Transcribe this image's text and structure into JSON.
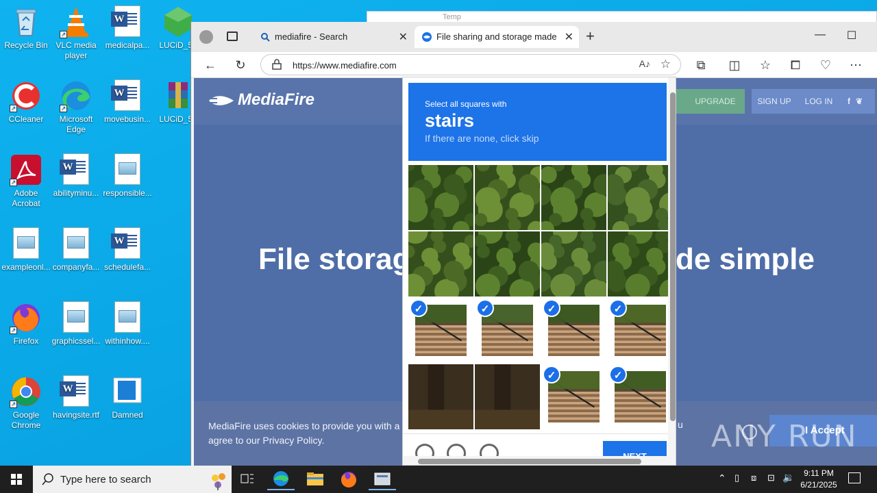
{
  "desktop": {
    "icons": [
      {
        "label": "Recycle Bin",
        "name": "recycle-bin-icon"
      },
      {
        "label": "VLC media player",
        "name": "vlc-icon"
      },
      {
        "label": "medicalpa...",
        "name": "word-doc-icon"
      },
      {
        "label": "LUCiD_5e",
        "name": "lucid-app-icon"
      },
      {
        "label": "CCleaner",
        "name": "ccleaner-icon"
      },
      {
        "label": "Microsoft Edge",
        "name": "edge-icon"
      },
      {
        "label": "movebusin...",
        "name": "word-doc-icon"
      },
      {
        "label": "LUCiD_5e",
        "name": "winrar-icon"
      },
      {
        "label": "Adobe Acrobat",
        "name": "acrobat-icon"
      },
      {
        "label": "abilityminu...",
        "name": "word-doc-icon"
      },
      {
        "label": "responsible...",
        "name": "image-file-icon"
      },
      {
        "label": "exampleonl...",
        "name": "image-file-icon"
      },
      {
        "label": "companyfa...",
        "name": "image-file-icon"
      },
      {
        "label": "schedulefa...",
        "name": "word-doc-icon"
      },
      {
        "label": "Firefox",
        "name": "firefox-icon"
      },
      {
        "label": "graphicssel...",
        "name": "image-file-icon"
      },
      {
        "label": "withinhow....",
        "name": "image-file-icon"
      },
      {
        "label": "Google Chrome",
        "name": "chrome-icon"
      },
      {
        "label": "havingsite.rtf",
        "name": "word-doc-icon"
      },
      {
        "label": "Damned",
        "name": "damned-file-icon"
      }
    ],
    "background_window_title": "Temp"
  },
  "browser": {
    "tabs": [
      {
        "title": "mediafire - Search",
        "icon": "search-icon"
      },
      {
        "title": "File sharing and storage made sim",
        "icon": "mediafire-icon"
      }
    ],
    "new_tab": "+",
    "url": "https://www.mediafire.com",
    "window_controls": {
      "minimize": "—",
      "maximize": "☐"
    }
  },
  "page": {
    "logo_text": "MediaFire",
    "nav": {
      "upgrade": "UPGRADE",
      "signup": "SIGN UP",
      "login": "LOG IN",
      "social": "f"
    },
    "hero_left": "File storag",
    "hero_right": "de simple",
    "cookie_text": "MediaFire uses cookies to provide you with a p",
    "cookie_text_line2": "agree to our Privacy Policy.",
    "cookie_tail": "u",
    "accept_label": "I Accept"
  },
  "captcha": {
    "prompt": "Select all squares with",
    "target": "stairs",
    "hint": "If there are none, click skip",
    "next_label": "NEXT",
    "tiles_selected": [
      false,
      false,
      false,
      false,
      false,
      false,
      false,
      false,
      true,
      true,
      true,
      true,
      false,
      false,
      true,
      true
    ],
    "colors": {
      "header": "#1d73e8",
      "check": "#1c6fe6"
    }
  },
  "taskbar": {
    "search_placeholder": "Type here to search",
    "time": "9:11 PM",
    "date": "6/21/2025"
  },
  "watermark": "ANY RUN"
}
